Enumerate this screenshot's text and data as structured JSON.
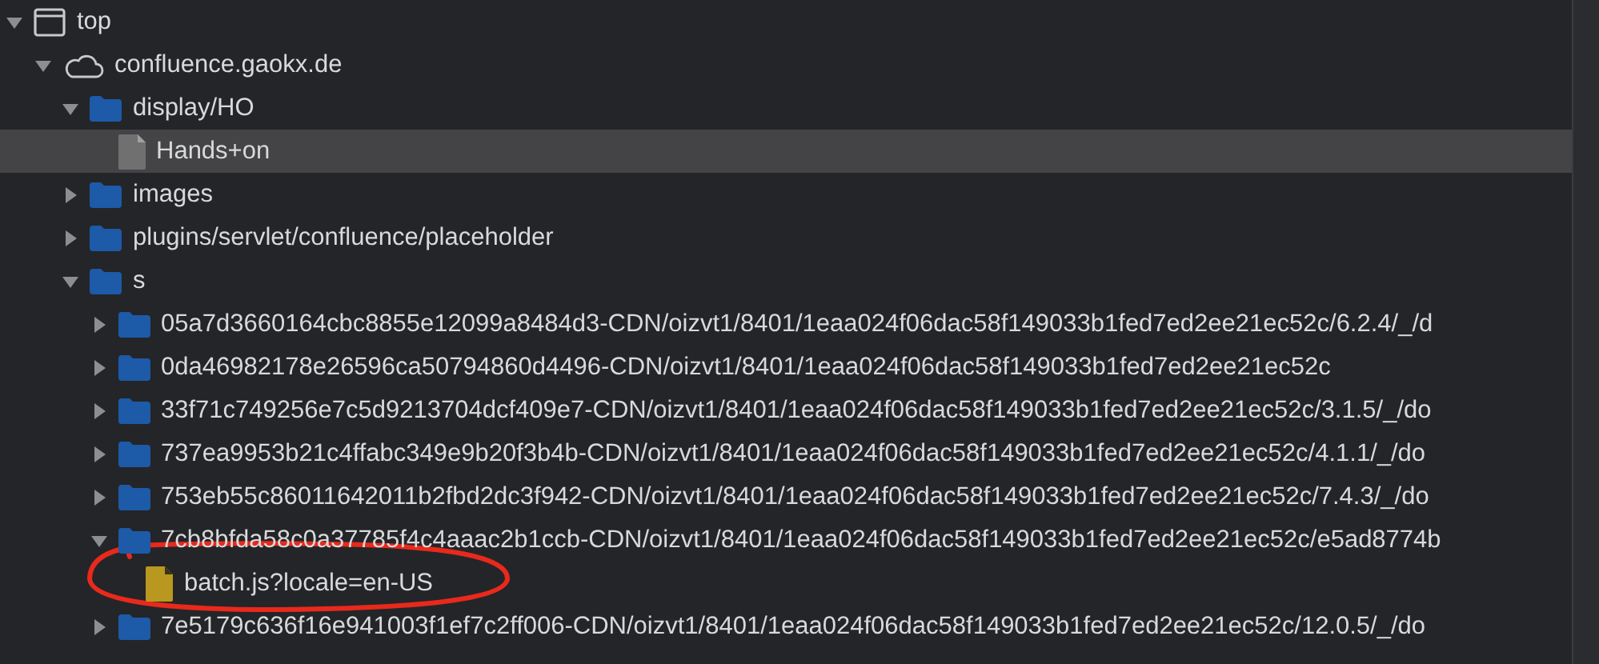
{
  "tree": [
    {
      "kind": "frame",
      "label": "top",
      "expanded": true,
      "selected": false,
      "children": [
        {
          "kind": "domain",
          "label": "confluence.gaokx.de",
          "expanded": true,
          "selected": false,
          "children": [
            {
              "kind": "folder",
              "label": "display/HO",
              "expanded": true,
              "selected": false,
              "children": [
                {
                  "kind": "page",
                  "label": "Hands+on",
                  "selected": true
                }
              ]
            },
            {
              "kind": "folder",
              "label": "images",
              "expanded": false,
              "selected": false
            },
            {
              "kind": "folder",
              "label": "plugins/servlet/confluence/placeholder",
              "expanded": false,
              "selected": false
            },
            {
              "kind": "folder",
              "label": "s",
              "expanded": true,
              "selected": false,
              "children": [
                {
                  "kind": "folder",
                  "label": "05a7d3660164cbc8855e12099a8484d3-CDN/oizvt1/8401/1eaa024f06dac58f149033b1fed7ed2ee21ec52c/6.2.4/_/d",
                  "expanded": false,
                  "selected": false
                },
                {
                  "kind": "folder",
                  "label": "0da46982178e26596ca50794860d4496-CDN/oizvt1/8401/1eaa024f06dac58f149033b1fed7ed2ee21ec52c",
                  "expanded": false,
                  "selected": false
                },
                {
                  "kind": "folder",
                  "label": "33f71c749256e7c5d9213704dcf409e7-CDN/oizvt1/8401/1eaa024f06dac58f149033b1fed7ed2ee21ec52c/3.1.5/_/do",
                  "expanded": false,
                  "selected": false
                },
                {
                  "kind": "folder",
                  "label": "737ea9953b21c4ffabc349e9b20f3b4b-CDN/oizvt1/8401/1eaa024f06dac58f149033b1fed7ed2ee21ec52c/4.1.1/_/do",
                  "expanded": false,
                  "selected": false
                },
                {
                  "kind": "folder",
                  "label": "753eb55c86011642011b2fbd2dc3f942-CDN/oizvt1/8401/1eaa024f06dac58f149033b1fed7ed2ee21ec52c/7.4.3/_/do",
                  "expanded": false,
                  "selected": false
                },
                {
                  "kind": "folder",
                  "label": "7cb8bfda58c0a37785f4c4aaac2b1ccb-CDN/oizvt1/8401/1eaa024f06dac58f149033b1fed7ed2ee21ec52c/e5ad8774b",
                  "expanded": true,
                  "selected": false,
                  "children": [
                    {
                      "kind": "script",
                      "label": "batch.js?locale=en-US",
                      "selected": false
                    }
                  ]
                },
                {
                  "kind": "folder",
                  "label": "7e5179c636f16e941003f1ef7c2ff006-CDN/oizvt1/8401/1eaa024f06dac58f149033b1fed7ed2ee21ec52c/12.0.5/_/do",
                  "expanded": false,
                  "selected": false
                }
              ]
            }
          ]
        }
      ]
    }
  ]
}
